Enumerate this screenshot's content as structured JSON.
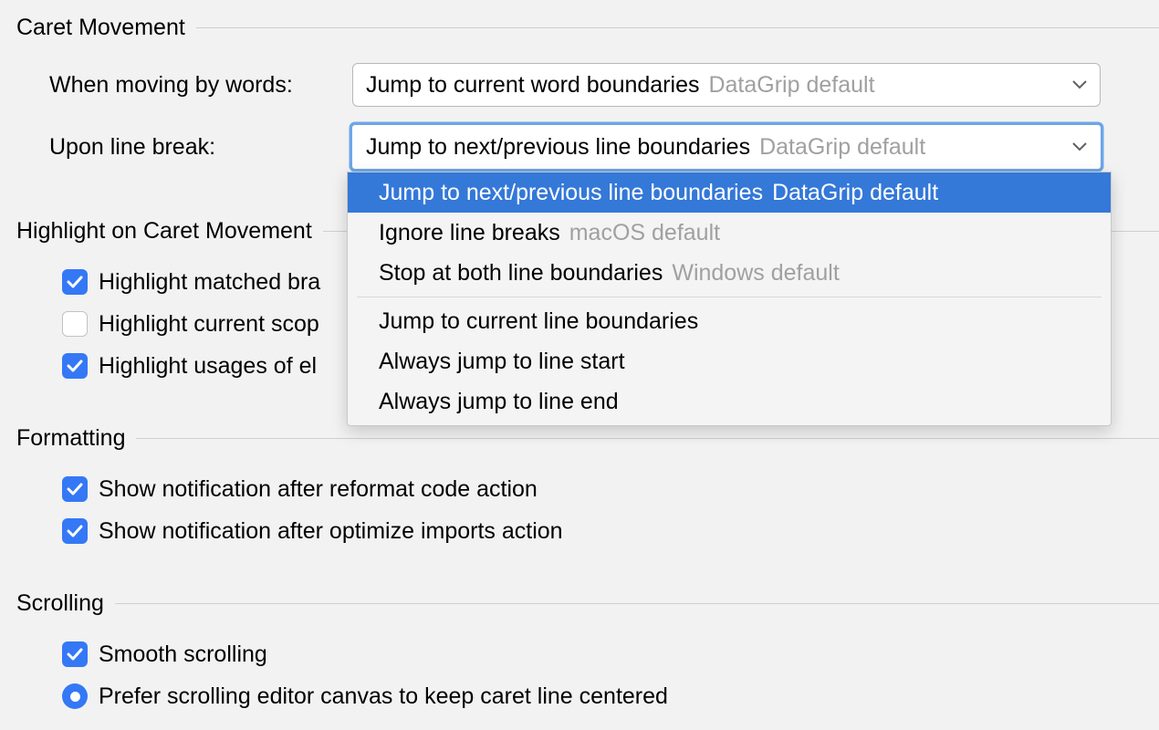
{
  "sections": {
    "caret_movement": {
      "title": "Caret Movement",
      "rows": {
        "moving_words": {
          "label": "When moving by words:",
          "value": "Jump to current word boundaries",
          "hint": "DataGrip default"
        },
        "line_break": {
          "label": "Upon line break:",
          "value": "Jump to next/previous line boundaries",
          "hint": "DataGrip default"
        }
      }
    },
    "highlight": {
      "title": "Highlight on Caret Movement",
      "items": {
        "matched_brace": "Highlight matched bra",
        "current_scope": "Highlight current scop",
        "usages": "Highlight usages of el"
      }
    },
    "formatting": {
      "title": "Formatting",
      "items": {
        "reformat": "Show notification after reformat code action",
        "optimize": "Show notification after optimize imports action"
      }
    },
    "scrolling": {
      "title": "Scrolling",
      "items": {
        "smooth": "Smooth scrolling",
        "prefer_center": "Prefer scrolling editor canvas to keep caret line centered"
      }
    }
  },
  "dropdown": {
    "options": [
      {
        "label": "Jump to next/previous line boundaries",
        "hint": "DataGrip default"
      },
      {
        "label": "Ignore line breaks",
        "hint": "macOS default"
      },
      {
        "label": "Stop at both line boundaries",
        "hint": "Windows default"
      },
      {
        "label": "Jump to current line boundaries",
        "hint": ""
      },
      {
        "label": "Always jump to line start",
        "hint": ""
      },
      {
        "label": "Always jump to line end",
        "hint": ""
      }
    ]
  }
}
